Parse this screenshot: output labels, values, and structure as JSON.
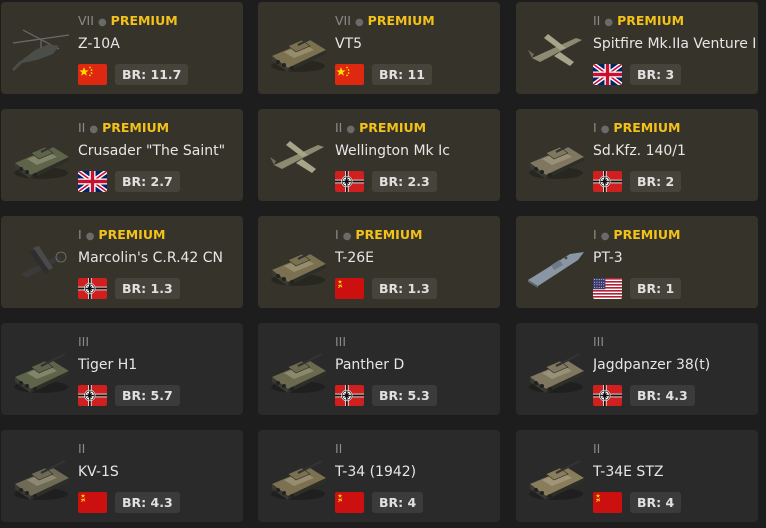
{
  "vehicles": [
    {
      "tier": "VII",
      "premium": true,
      "premium_label": "PREMIUM",
      "name": "Z-10A",
      "nation": "china",
      "br": "BR: 11.7",
      "kind": "heli"
    },
    {
      "tier": "VII",
      "premium": true,
      "premium_label": "PREMIUM",
      "name": "VT5",
      "nation": "china",
      "br": "BR: 11",
      "kind": "tank"
    },
    {
      "tier": "II",
      "premium": true,
      "premium_label": "PREMIUM",
      "name": "Spitfire Mk.IIa Venture I",
      "nation": "uk",
      "br": "BR: 3",
      "kind": "plane"
    },
    {
      "tier": "II",
      "premium": true,
      "premium_label": "PREMIUM",
      "name": "Crusader \"The Saint\"",
      "nation": "uk",
      "br": "BR: 2.7",
      "kind": "tank"
    },
    {
      "tier": "II",
      "premium": true,
      "premium_label": "PREMIUM",
      "name": "Wellington Mk Ic",
      "nation": "germany",
      "br": "BR: 2.3",
      "kind": "plane"
    },
    {
      "tier": "I",
      "premium": true,
      "premium_label": "PREMIUM",
      "name": "Sd.Kfz. 140/1",
      "nation": "germany",
      "br": "BR: 2",
      "kind": "tank"
    },
    {
      "tier": "I",
      "premium": true,
      "premium_label": "PREMIUM",
      "name": "Marcolin's C.R.42 CN",
      "nation": "germany",
      "br": "BR: 1.3",
      "kind": "biplane"
    },
    {
      "tier": "I",
      "premium": true,
      "premium_label": "PREMIUM",
      "name": "T-26E",
      "nation": "ussr",
      "br": "BR: 1.3",
      "kind": "tank"
    },
    {
      "tier": "I",
      "premium": true,
      "premium_label": "PREMIUM",
      "name": "PT-3",
      "nation": "usa",
      "br": "BR: 1",
      "kind": "boat"
    },
    {
      "tier": "III",
      "premium": false,
      "premium_label": "",
      "name": "Tiger H1",
      "nation": "germany",
      "br": "BR: 5.7",
      "kind": "tank"
    },
    {
      "tier": "III",
      "premium": false,
      "premium_label": "",
      "name": "Panther D",
      "nation": "germany",
      "br": "BR: 5.3",
      "kind": "tank"
    },
    {
      "tier": "III",
      "premium": false,
      "premium_label": "",
      "name": "Jagdpanzer 38(t)",
      "nation": "germany",
      "br": "BR: 4.3",
      "kind": "tank"
    },
    {
      "tier": "II",
      "premium": false,
      "premium_label": "",
      "name": "KV-1S",
      "nation": "ussr",
      "br": "BR: 4.3",
      "kind": "tank"
    },
    {
      "tier": "II",
      "premium": false,
      "premium_label": "",
      "name": "T-34 (1942)",
      "nation": "ussr",
      "br": "BR: 4",
      "kind": "tank"
    },
    {
      "tier": "II",
      "premium": false,
      "premium_label": "",
      "name": "T-34E STZ",
      "nation": "ussr",
      "br": "BR: 4",
      "kind": "tank"
    }
  ],
  "colors": {
    "premium_text": "#f2c11a",
    "premium_card": "#36342a",
    "normal_card": "#2a2a2a",
    "background": "#1d1d1d"
  }
}
